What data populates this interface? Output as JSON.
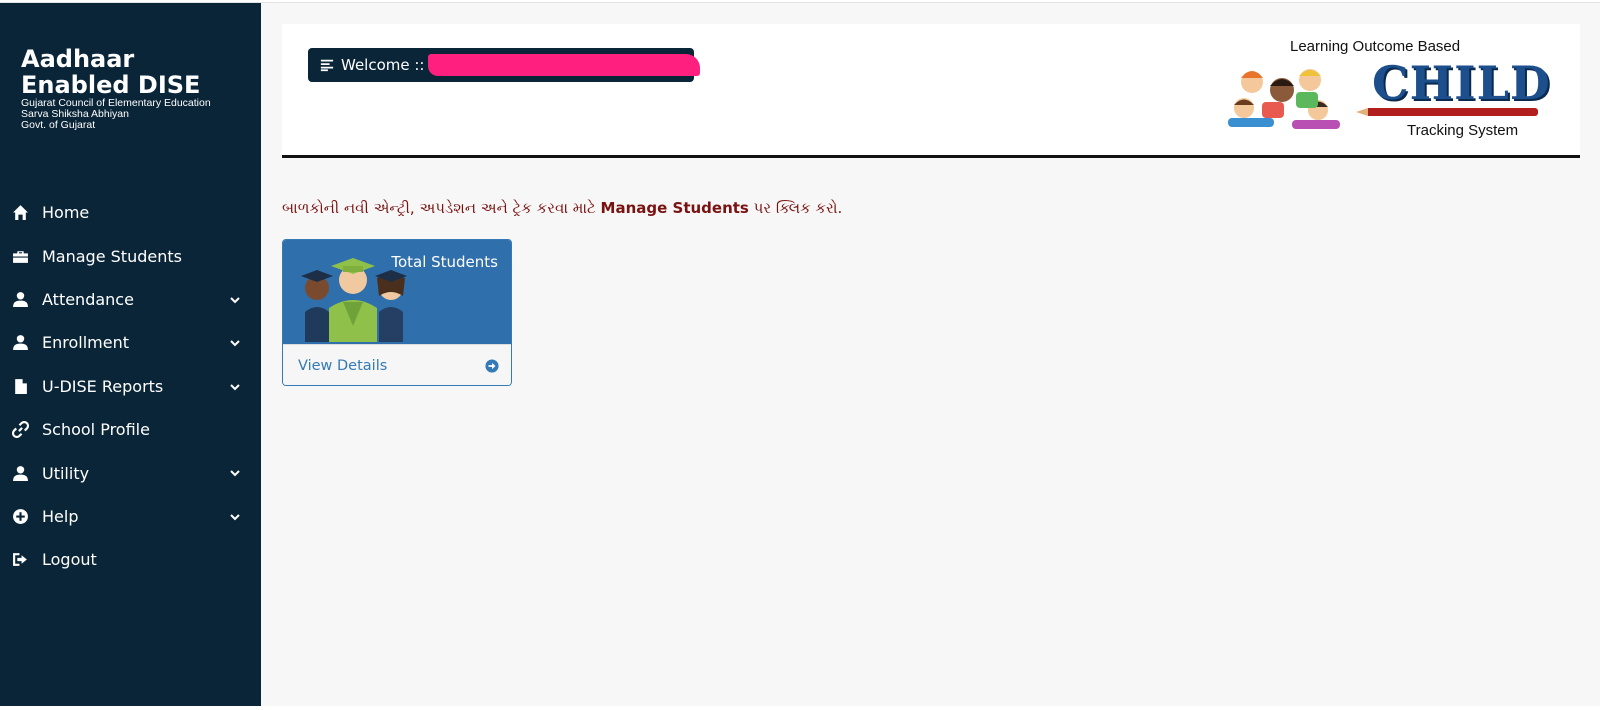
{
  "brand": {
    "title": "Aadhaar\nEnabled DISE",
    "subtitle_lines": [
      "Gujarat Council of Elementary Education",
      "Sarva Shiksha Abhiyan",
      "Govt. of Gujarat"
    ]
  },
  "nav": {
    "items": [
      {
        "label": "Home",
        "icon": "home-icon",
        "has_submenu": false
      },
      {
        "label": "Manage Students",
        "icon": "briefcase-icon",
        "has_submenu": false
      },
      {
        "label": "Attendance",
        "icon": "user-icon",
        "has_submenu": true
      },
      {
        "label": "Enrollment",
        "icon": "user-icon",
        "has_submenu": true
      },
      {
        "label": "U-DISE Reports",
        "icon": "file-icon",
        "has_submenu": true
      },
      {
        "label": "School Profile",
        "icon": "link-icon",
        "has_submenu": false
      },
      {
        "label": "Utility",
        "icon": "user-icon",
        "has_submenu": true
      },
      {
        "label": "Help",
        "icon": "plus-circle-icon",
        "has_submenu": true
      },
      {
        "label": "Logout",
        "icon": "logout-icon",
        "has_submenu": false
      }
    ]
  },
  "header": {
    "welcome_label": "Welcome ::",
    "logo_top": "Learning Outcome Based",
    "logo_main": "CHILD",
    "logo_bottom": "Tracking System"
  },
  "notice": {
    "prefix": "બાળકોની નવી એન્ટ્રી, અપડેશન અને ટ્રેક કરવા માટે ",
    "link_text": "Manage Students",
    "suffix": " પર ક્લિક કરો."
  },
  "card": {
    "title": "Total Students",
    "footer_label": "View Details"
  },
  "colors": {
    "sidebar_bg": "#0a2538",
    "accent_blue": "#337ab7",
    "notice_text": "#7a1212",
    "redaction": "#ff1f7e"
  }
}
